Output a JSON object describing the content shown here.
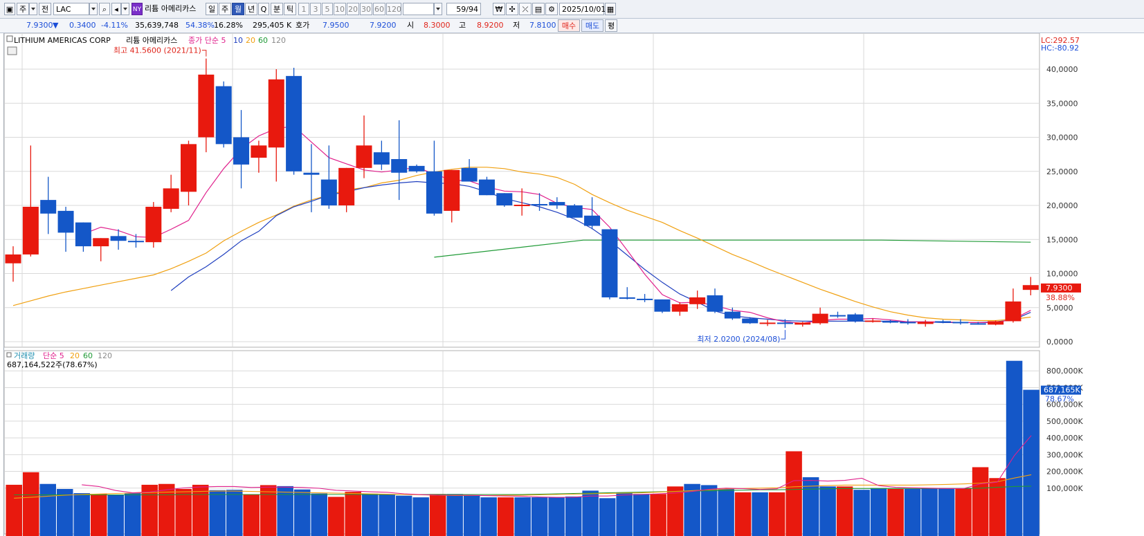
{
  "toolbar": {
    "period_label": "주",
    "prev_label": "전",
    "symbol": "LAC",
    "market_badge": "NY",
    "stock_name": "리튬 아메리카스",
    "timeframes": [
      "일",
      "주",
      "월",
      "년",
      "Q"
    ],
    "selected_timeframe": "월",
    "minute_label": "분",
    "tick_label": "틱",
    "intervals": [
      "1",
      "3",
      "5",
      "10",
      "20",
      "30",
      "60",
      "120"
    ],
    "page_counter": "59/94",
    "currency_icon": "₩",
    "date": "2025/10/01"
  },
  "quote": {
    "price": "7.9300",
    "change_arrow": "▼",
    "change": "0.3400",
    "change_pct": "-4.11%",
    "volume": "35,639,748",
    "volume_ratio": "54.38%",
    "turnover": "16.28%",
    "amount": "295,405 K",
    "bid_label": "호가",
    "bid": "7.9500",
    "ask": "7.9200",
    "open_label": "시",
    "open": "8.3000",
    "high_label": "고",
    "high": "8.9200",
    "low_label": "저",
    "low": "7.8100",
    "buy_label": "매수",
    "sell_label": "매도",
    "avg_label": "평"
  },
  "chart_data": {
    "type": "candlestick",
    "title": "LITHIUM AMERICAS CORP",
    "title_kr": "리튬 아메리카스",
    "indicator_label": "종가 단순 5",
    "ma_periods": [
      "10",
      "20",
      "60",
      "120"
    ],
    "corner_info": [
      "LC:292.57",
      "HC:-80.92"
    ],
    "price_axis": {
      "min": 0,
      "max": 40000,
      "ticks": [
        "40,0000",
        "35,0000",
        "30,0000",
        "25,0000",
        "20,0000",
        "15,0000",
        "10,0000",
        "5,0000",
        "0,0000"
      ],
      "tick_values": [
        40,
        35,
        30,
        25,
        20,
        15,
        10,
        5,
        0
      ]
    },
    "current_price_label": "7.9300",
    "current_pct_label": "38.88%",
    "current_price": 7.93,
    "high_annotation": "최고 41.5600 (2021/11)",
    "high_annotation_index": 11,
    "low_annotation": "최저 2.0200 (2024/08)",
    "low_annotation_index": 44,
    "candles": [
      {
        "o": 11.5,
        "h": 14.0,
        "l": 8.8,
        "c": 12.8
      },
      {
        "o": 12.8,
        "h": 28.8,
        "l": 12.5,
        "c": 19.8
      },
      {
        "o": 20.8,
        "h": 24.2,
        "l": 15.8,
        "c": 18.8
      },
      {
        "o": 19.2,
        "h": 19.8,
        "l": 13.2,
        "c": 16.0
      },
      {
        "o": 17.5,
        "h": 17.5,
        "l": 13.2,
        "c": 14.0
      },
      {
        "o": 14.0,
        "h": 15.2,
        "l": 11.8,
        "c": 15.2
      },
      {
        "o": 15.5,
        "h": 16.5,
        "l": 13.5,
        "c": 14.8
      },
      {
        "o": 14.8,
        "h": 15.8,
        "l": 13.8,
        "c": 14.6
      },
      {
        "o": 14.6,
        "h": 20.5,
        "l": 13.8,
        "c": 19.8
      },
      {
        "o": 19.5,
        "h": 24.5,
        "l": 19.0,
        "c": 22.5
      },
      {
        "o": 22.0,
        "h": 29.5,
        "l": 20.0,
        "c": 29.0
      },
      {
        "o": 30.0,
        "h": 41.56,
        "l": 27.8,
        "c": 39.2
      },
      {
        "o": 37.5,
        "h": 38.2,
        "l": 28.5,
        "c": 29.0
      },
      {
        "o": 30.0,
        "h": 34.0,
        "l": 22.5,
        "c": 26.0
      },
      {
        "o": 27.0,
        "h": 29.5,
        "l": 24.8,
        "c": 28.8
      },
      {
        "o": 28.5,
        "h": 40.0,
        "l": 23.5,
        "c": 38.5
      },
      {
        "o": 39.0,
        "h": 40.2,
        "l": 24.5,
        "c": 25.0
      },
      {
        "o": 24.8,
        "h": 29.0,
        "l": 19.0,
        "c": 24.5
      },
      {
        "o": 23.8,
        "h": 28.8,
        "l": 19.5,
        "c": 20.0
      },
      {
        "o": 20.0,
        "h": 25.5,
        "l": 19.0,
        "c": 25.5
      },
      {
        "o": 25.5,
        "h": 33.2,
        "l": 24.0,
        "c": 28.8
      },
      {
        "o": 27.8,
        "h": 29.5,
        "l": 25.2,
        "c": 26.0
      },
      {
        "o": 26.8,
        "h": 32.5,
        "l": 20.8,
        "c": 24.8
      },
      {
        "o": 25.8,
        "h": 26.0,
        "l": 24.8,
        "c": 25.0
      },
      {
        "o": 25.0,
        "h": 29.5,
        "l": 18.5,
        "c": 18.8
      },
      {
        "o": 19.2,
        "h": 25.2,
        "l": 17.5,
        "c": 25.2
      },
      {
        "o": 25.5,
        "h": 26.8,
        "l": 23.5,
        "c": 23.5
      },
      {
        "o": 23.8,
        "h": 24.2,
        "l": 21.5,
        "c": 21.5
      },
      {
        "o": 21.8,
        "h": 21.8,
        "l": 19.8,
        "c": 20.0
      },
      {
        "o": 19.9,
        "h": 22.5,
        "l": 18.5,
        "c": 20.1
      },
      {
        "o": 20.2,
        "h": 21.8,
        "l": 19.2,
        "c": 20.0
      },
      {
        "o": 20.5,
        "h": 21.2,
        "l": 19.5,
        "c": 20.0
      },
      {
        "o": 20.0,
        "h": 20.2,
        "l": 18.2,
        "c": 18.2
      },
      {
        "o": 18.5,
        "h": 21.2,
        "l": 16.5,
        "c": 17.0
      },
      {
        "o": 16.5,
        "h": 16.5,
        "l": 6.2,
        "c": 6.5
      },
      {
        "o": 6.5,
        "h": 8.0,
        "l": 6.2,
        "c": 6.3
      },
      {
        "o": 6.3,
        "h": 7.0,
        "l": 5.8,
        "c": 6.1
      },
      {
        "o": 6.2,
        "h": 6.2,
        "l": 4.2,
        "c": 4.4
      },
      {
        "o": 4.4,
        "h": 5.8,
        "l": 3.8,
        "c": 5.5
      },
      {
        "o": 5.5,
        "h": 7.5,
        "l": 4.8,
        "c": 6.5
      },
      {
        "o": 6.8,
        "h": 7.8,
        "l": 4.2,
        "c": 4.4
      },
      {
        "o": 4.4,
        "h": 5.0,
        "l": 3.2,
        "c": 3.4
      },
      {
        "o": 3.4,
        "h": 3.6,
        "l": 2.6,
        "c": 2.7
      },
      {
        "o": 2.7,
        "h": 3.2,
        "l": 2.3,
        "c": 2.8
      },
      {
        "o": 2.8,
        "h": 3.3,
        "l": 2.02,
        "c": 2.6
      },
      {
        "o": 2.5,
        "h": 2.9,
        "l": 2.2,
        "c": 2.8
      },
      {
        "o": 2.7,
        "h": 5.0,
        "l": 2.5,
        "c": 4.1
      },
      {
        "o": 3.9,
        "h": 4.4,
        "l": 3.5,
        "c": 3.8
      },
      {
        "o": 4.0,
        "h": 4.2,
        "l": 2.8,
        "c": 3.0
      },
      {
        "o": 3.1,
        "h": 3.4,
        "l": 2.8,
        "c": 3.1
      },
      {
        "o": 3.0,
        "h": 3.2,
        "l": 2.7,
        "c": 2.9
      },
      {
        "o": 2.9,
        "h": 3.3,
        "l": 2.5,
        "c": 2.7
      },
      {
        "o": 2.6,
        "h": 3.2,
        "l": 2.2,
        "c": 2.9
      },
      {
        "o": 3.0,
        "h": 3.2,
        "l": 2.7,
        "c": 2.9
      },
      {
        "o": 2.9,
        "h": 3.3,
        "l": 2.5,
        "c": 2.8
      },
      {
        "o": 2.7,
        "h": 2.9,
        "l": 2.5,
        "c": 2.6
      },
      {
        "o": 2.5,
        "h": 3.1,
        "l": 2.4,
        "c": 3.0
      },
      {
        "o": 3.0,
        "h": 7.8,
        "l": 2.8,
        "c": 5.9
      },
      {
        "o": 7.6,
        "h": 9.5,
        "l": 6.8,
        "c": 8.3
      }
    ],
    "ma5": [
      null,
      null,
      null,
      null,
      15.8,
      16.8,
      16.3,
      15.4,
      15.3,
      16.5,
      17.8,
      21.9,
      25.4,
      28.3,
      30.2,
      31.3,
      31.6,
      29.3,
      27.0,
      26.1,
      25.2,
      24.9,
      25.2,
      25.6,
      24.6,
      23.7,
      23.6,
      22.7,
      22.1,
      22.0,
      21.6,
      20.3,
      19.7,
      19.4,
      16.8,
      13.4,
      9.9,
      6.9,
      5.7,
      5.8,
      5.3,
      4.6,
      4.3,
      3.5,
      2.9,
      2.7,
      3.1,
      3.3,
      3.3,
      3.4,
      3.2,
      2.9,
      2.9,
      2.9,
      2.8,
      2.8,
      2.8,
      3.3,
      4.6
    ],
    "ma10": [
      null,
      null,
      null,
      null,
      null,
      null,
      null,
      null,
      null,
      7.5,
      9.5,
      11.0,
      12.8,
      14.8,
      16.2,
      18.5,
      19.8,
      20.6,
      21.5,
      22.0,
      22.6,
      23.0,
      23.3,
      23.5,
      23.3,
      23.2,
      22.8,
      22.0,
      21.0,
      20.4,
      19.8,
      19.0,
      18.0,
      16.6,
      14.8,
      12.7,
      10.6,
      8.7,
      7.0,
      5.8,
      4.5,
      3.8,
      3.5,
      3.3,
      3.1,
      3.0,
      3.0,
      3.0,
      3.0,
      3.0,
      3.0,
      2.9,
      2.9,
      2.8,
      2.8,
      2.8,
      2.9,
      3.2,
      4.3
    ],
    "ma20": [
      5.3,
      6.0,
      6.7,
      7.3,
      7.8,
      8.3,
      8.8,
      9.3,
      9.8,
      10.7,
      11.8,
      13.0,
      14.8,
      16.2,
      17.5,
      18.6,
      19.9,
      20.8,
      21.5,
      22.3,
      22.6,
      23.3,
      23.7,
      24.4,
      24.9,
      25.3,
      25.6,
      25.6,
      25.4,
      24.9,
      24.6,
      24.1,
      23.1,
      21.6,
      20.4,
      19.3,
      18.4,
      17.5,
      16.3,
      15.2,
      14.0,
      12.8,
      11.8,
      10.7,
      9.7,
      8.7,
      7.7,
      6.8,
      5.9,
      5.1,
      4.4,
      3.9,
      3.5,
      3.3,
      3.2,
      3.1,
      3.1,
      3.3,
      3.6
    ],
    "ma60": {
      "start": 24,
      "values": [
        12.4,
        14.9,
        14.9,
        14.9,
        14.6
      ]
    },
    "volume_label": "거래량",
    "volume_indicator": "단순 5",
    "volume_ma_periods": [
      "20",
      "60",
      "120"
    ],
    "volume_readout": "687,164,522주(78.67%)",
    "volume_axis": {
      "max": 900,
      "ticks": [
        "800,000K",
        "700,000K",
        "600,000K",
        "500,000K",
        "400,000K",
        "300,000K",
        "200,000K",
        "100,000K"
      ],
      "tick_values": [
        800,
        700,
        600,
        500,
        400,
        300,
        200,
        100
      ]
    },
    "current_volume_label": "687,165K",
    "current_volume_pct": "78.67%",
    "volumes": [
      120,
      195,
      125,
      95,
      70,
      65,
      60,
      70,
      120,
      125,
      95,
      120,
      88,
      90,
      62,
      118,
      112,
      92,
      68,
      48,
      78,
      67,
      60,
      55,
      45,
      65,
      65,
      55,
      45,
      45,
      45,
      45,
      45,
      50,
      85,
      40,
      75,
      65,
      65,
      110,
      125,
      118,
      95,
      75,
      75,
      75,
      320,
      165,
      110,
      110,
      90,
      100,
      95,
      95,
      100,
      100,
      100,
      225,
      160,
      860,
      687
    ],
    "volume_ma5": [
      null,
      null,
      null,
      null,
      120,
      110,
      86,
      72,
      77,
      90,
      101,
      107,
      110,
      110,
      104,
      106,
      106,
      104,
      99,
      87,
      83,
      78,
      75,
      66,
      61,
      58,
      58,
      57,
      55,
      53,
      51,
      47,
      45,
      46,
      53,
      53,
      59,
      62,
      66,
      71,
      80,
      93,
      100,
      97,
      92,
      96,
      145,
      146,
      142,
      146,
      159,
      115,
      105,
      102,
      100,
      98,
      97,
      125,
      136,
      294,
      414
    ],
    "volume_ma20": [
      40,
      45,
      52,
      58,
      62,
      65,
      68,
      70,
      73,
      76,
      78,
      80,
      82,
      82,
      80,
      78,
      76,
      74,
      72,
      70,
      68,
      66,
      64,
      62,
      60,
      58,
      56,
      56,
      56,
      57,
      58,
      60,
      62,
      64,
      66,
      68,
      70,
      72,
      76,
      80,
      85,
      90,
      95,
      98,
      100,
      102,
      108,
      112,
      115,
      118,
      118,
      118,
      118,
      118,
      120,
      122,
      125,
      130,
      138,
      160,
      180
    ],
    "volume_ma60": [
      60,
      60,
      60,
      60,
      60,
      60,
      60,
      60,
      60,
      60,
      62,
      62,
      62,
      62,
      62,
      62,
      62,
      62,
      62,
      62,
      62,
      62,
      62,
      62,
      62,
      62,
      62,
      62,
      62,
      62,
      62,
      64,
      66,
      68,
      70,
      72,
      74,
      76,
      78,
      80,
      82,
      84,
      86,
      88,
      90,
      90,
      92,
      94,
      96,
      98,
      98,
      98,
      98,
      98,
      98,
      98,
      98,
      100,
      105,
      110,
      112
    ],
    "colors": {
      "up": "#e8190e",
      "down": "#1457c8",
      "ma5": "#e0208c",
      "ma10": "#1f3fbf",
      "ma20": "#f0a010",
      "ma60": "#1f9a36",
      "ma120": "#8a8a8a",
      "grid": "#d9d9d9"
    }
  }
}
